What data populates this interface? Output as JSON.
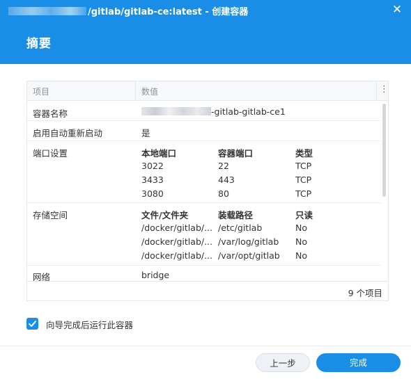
{
  "window": {
    "title_suffix": "/gitlab/gitlab-ce:latest - 创建容器",
    "close_glyph": "✕"
  },
  "page": {
    "title": "摘要"
  },
  "table": {
    "headers": {
      "item": "项目",
      "value": "数值",
      "menu_glyph": "⋮"
    },
    "rows": {
      "container_name": {
        "label": "容器名称",
        "value": "-gitlab-gitlab-ce1"
      },
      "auto_restart": {
        "label": "启用自动重新启动",
        "value": "是"
      },
      "ports": {
        "label": "端口设置",
        "headers": [
          "本地端口",
          "容器端口",
          "类型"
        ],
        "items": [
          [
            "3022",
            "22",
            "TCP"
          ],
          [
            "3433",
            "443",
            "TCP"
          ],
          [
            "3080",
            "80",
            "TCP"
          ]
        ]
      },
      "storage": {
        "label": "存储空间",
        "headers": [
          "文件/文件夹",
          "装载路径",
          "只读"
        ],
        "items": [
          [
            "/docker/gitlab/...",
            "/etc/gitlab",
            "No"
          ],
          [
            "/docker/gitlab/...",
            "/var/log/gitlab",
            "No"
          ],
          [
            "/docker/gitlab/...",
            "/var/opt/gitlab",
            "No"
          ]
        ]
      },
      "network": {
        "label": "网络",
        "value": "bridge"
      }
    },
    "footer": {
      "count": "9 个项目"
    }
  },
  "options": {
    "run_after_wizard": {
      "label": "向导完成后运行此容器",
      "checked": true
    }
  },
  "buttons": {
    "prev": "上一步",
    "done": "完成"
  },
  "colors": {
    "accent": "#1a8ee6"
  }
}
